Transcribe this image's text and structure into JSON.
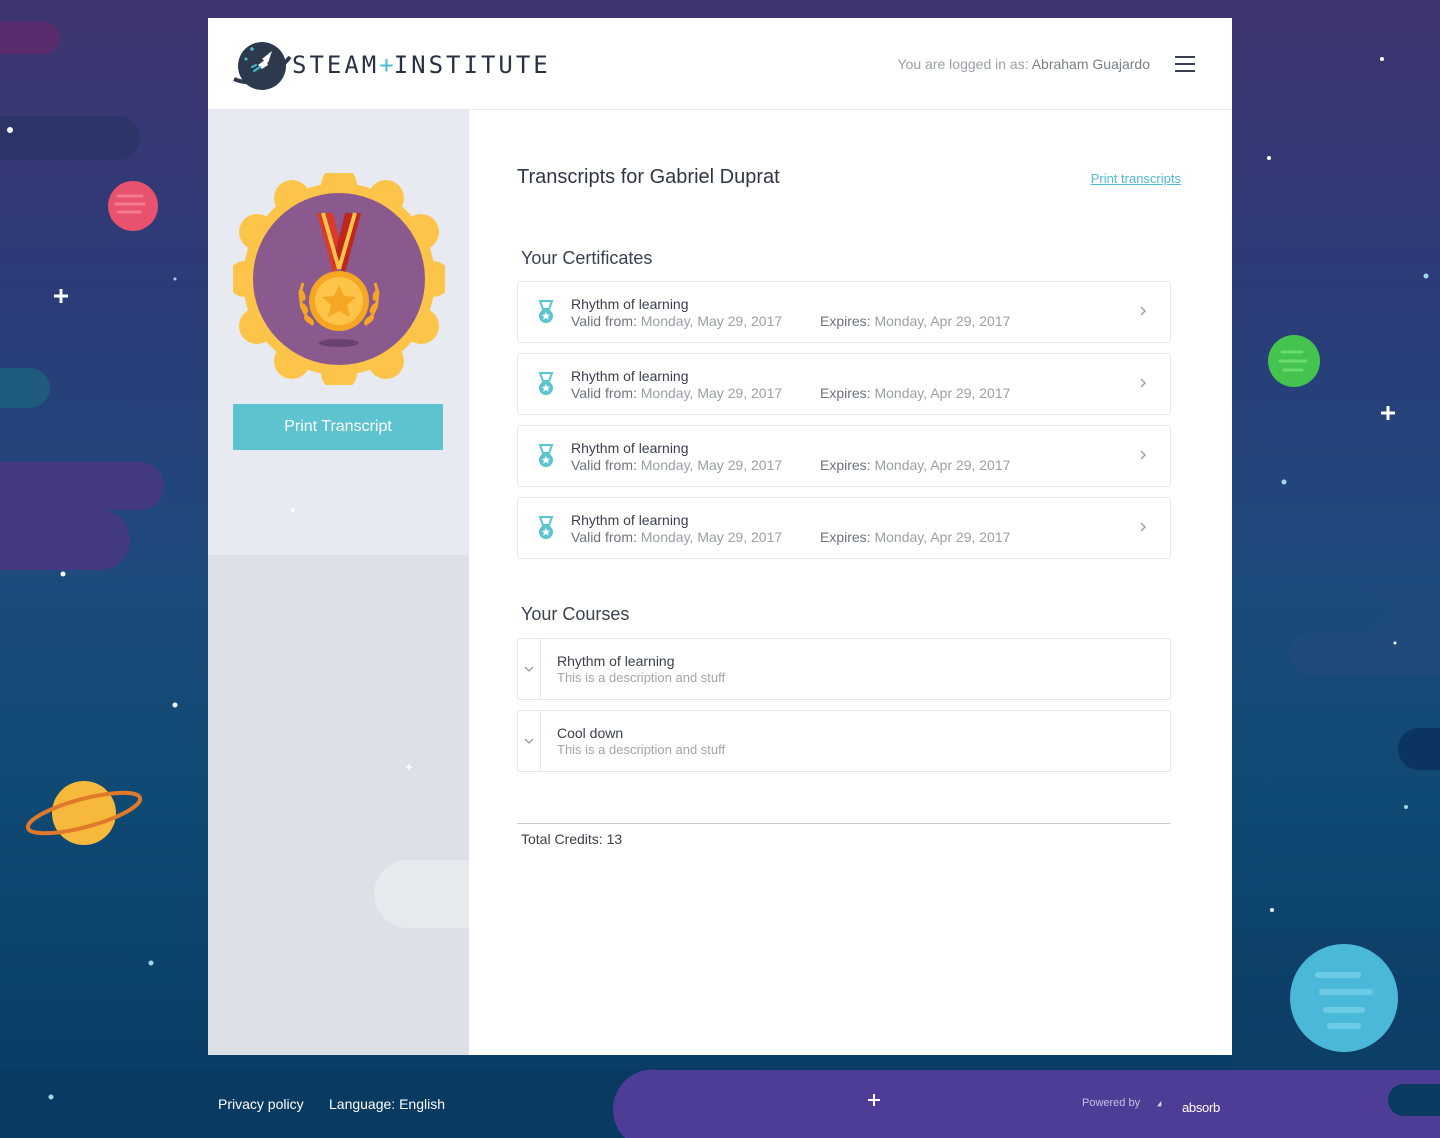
{
  "header": {
    "logo_main": "STEAM",
    "logo_plus": "+",
    "logo_sub": "INSTITUTE",
    "login_prefix": "You are logged in as:",
    "user_name": "Abraham Guajardo"
  },
  "sidebar": {
    "print_button": "Print Transcript"
  },
  "main": {
    "title": "Transcripts for Gabriel Duprat",
    "print_link": "Print transcripts",
    "certificates_title": "Your Certificates",
    "valid_label": "Valid from:",
    "expires_label": "Expires:",
    "certificates": [
      {
        "name": "Rhythm of learning",
        "valid": "Monday, May 29, 2017",
        "expires": "Monday, Apr 29, 2017"
      },
      {
        "name": "Rhythm of learning",
        "valid": "Monday, May 29, 2017",
        "expires": "Monday, Apr 29, 2017"
      },
      {
        "name": "Rhythm of learning",
        "valid": "Monday, May 29, 2017",
        "expires": "Monday, Apr 29, 2017"
      },
      {
        "name": "Rhythm of learning",
        "valid": "Monday, May 29, 2017",
        "expires": "Monday, Apr 29, 2017"
      }
    ],
    "courses_title": "Your Courses",
    "courses": [
      {
        "name": "Rhythm of learning",
        "description": "This is a description and stuff"
      },
      {
        "name": "Cool down",
        "description": "This is a description and stuff"
      }
    ],
    "total_credits": "Total Credits: 13"
  },
  "footer": {
    "privacy": "Privacy policy",
    "language_label": "Language:",
    "language_value": "English",
    "powered_by": "Powered by",
    "brand": "absorb"
  },
  "colors": {
    "accent": "#5dc3cf",
    "link": "#4fbbd0",
    "badge_outer": "#fcc54a",
    "badge_inner": "#8a5a8e"
  },
  "icons": [
    "rocket-planet-logo-icon",
    "hamburger-menu-icon",
    "medal-icon",
    "chevron-right-icon",
    "chevron-down-icon",
    "absorb-logo-icon"
  ]
}
